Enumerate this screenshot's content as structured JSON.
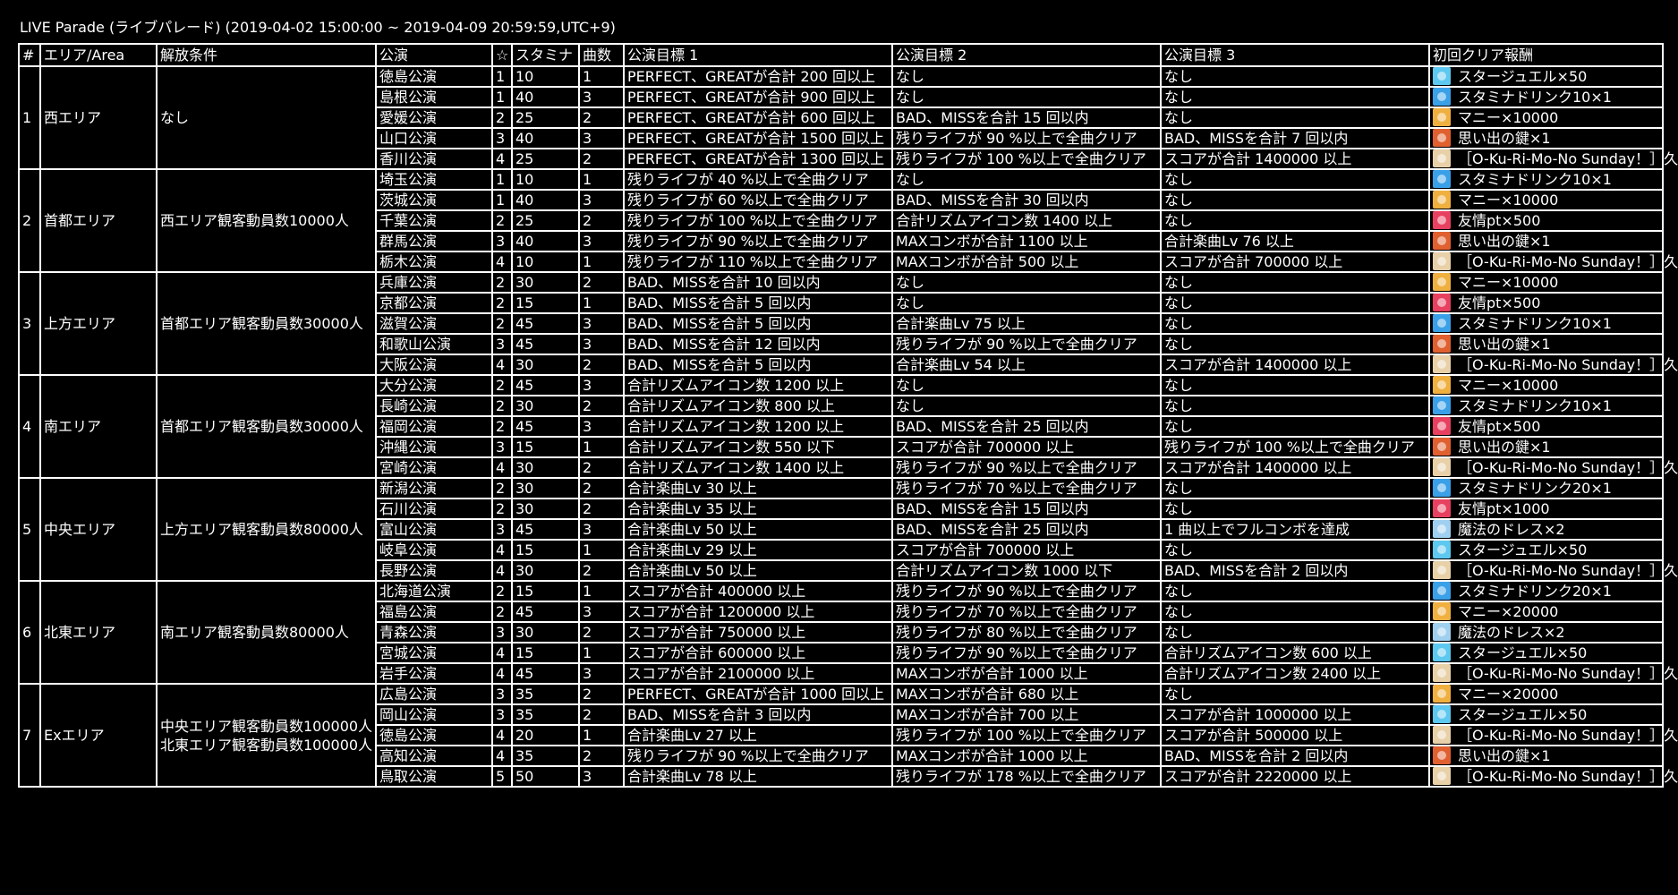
{
  "title": "LIVE Parade (ライブパレード) (2019-04-02 15:00:00 ~ 2019-04-09 20:59:59,UTC+9)",
  "columns": [
    "#",
    "エリア/Area",
    "解放条件",
    "公演",
    "☆",
    "スタミナ",
    "曲数",
    "公演目標 1",
    "公演目標 2",
    "公演目標 3",
    "初回クリア報酬"
  ],
  "reward_icons": {
    "jewel-icon": "#5dc8f0",
    "stamina-drink-icon": "#3aa0e8",
    "money-icon": "#f0b040",
    "key-icon": "#e06030",
    "card-icon": "#e8d0a8",
    "friend-pt-icon": "#e84060",
    "dress-icon": "#a0d0f0"
  },
  "areas": [
    {
      "num": "1",
      "name": "西エリア",
      "condition": [
        "なし"
      ],
      "lives": [
        {
          "name": "徳島公演",
          "star": "1",
          "stamina": "10",
          "songs": "1",
          "g1": "PERFECT、GREATが合計 200 回以上",
          "g2": "なし",
          "g3": "なし",
          "reward": "スタージュエル×50",
          "icon": "jewel-icon"
        },
        {
          "name": "島根公演",
          "star": "1",
          "stamina": "40",
          "songs": "3",
          "g1": "PERFECT、GREATが合計 900 回以上",
          "g2": "なし",
          "g3": "なし",
          "reward": "スタミナドリンク10×1",
          "icon": "stamina-drink-icon"
        },
        {
          "name": "愛媛公演",
          "star": "2",
          "stamina": "25",
          "songs": "2",
          "g1": "PERFECT、GREATが合計 600 回以上",
          "g2": "BAD、MISSを合計 15 回以内",
          "g3": "なし",
          "reward": "マニー×10000",
          "icon": "money-icon"
        },
        {
          "name": "山口公演",
          "star": "3",
          "stamina": "40",
          "songs": "3",
          "g1": "PERFECT、GREATが合計 1500 回以上",
          "g2": "残りライフが 90 %以上で全曲クリア",
          "g3": "BAD、MISSを合計 7 回以内",
          "reward": "思い出の鍵×1",
          "icon": "key-icon"
        },
        {
          "name": "香川公演",
          "star": "4",
          "stamina": "25",
          "songs": "2",
          "g1": "PERFECT、GREATが合計 1300 回以上",
          "g2": "残りライフが 100 %以上で全曲クリア",
          "g3": "スコアが合計 1400000 以上",
          "reward": "［O-Ku-Ri-Mo-No Sunday！］久",
          "icon": "card-icon"
        }
      ]
    },
    {
      "num": "2",
      "name": "首都エリア",
      "condition": [
        "西エリア観客動員数10000人"
      ],
      "lives": [
        {
          "name": "埼玉公演",
          "star": "1",
          "stamina": "10",
          "songs": "1",
          "g1": "残りライフが 40 %以上で全曲クリア",
          "g2": "なし",
          "g3": "なし",
          "reward": "スタミナドリンク10×1",
          "icon": "stamina-drink-icon"
        },
        {
          "name": "茨城公演",
          "star": "1",
          "stamina": "40",
          "songs": "3",
          "g1": "残りライフが 60 %以上で全曲クリア",
          "g2": "BAD、MISSを合計 30 回以内",
          "g3": "なし",
          "reward": "マニー×10000",
          "icon": "money-icon"
        },
        {
          "name": "千葉公演",
          "star": "2",
          "stamina": "25",
          "songs": "2",
          "g1": "残りライフが 100 %以上で全曲クリア",
          "g2": "合計リズムアイコン数 1400 以上",
          "g3": "なし",
          "reward": "友情pt×500",
          "icon": "friend-pt-icon"
        },
        {
          "name": "群馬公演",
          "star": "3",
          "stamina": "40",
          "songs": "3",
          "g1": "残りライフが 90 %以上で全曲クリア",
          "g2": "MAXコンボが合計 1100 以上",
          "g3": "合計楽曲Lv 76 以上",
          "reward": "思い出の鍵×1",
          "icon": "key-icon"
        },
        {
          "name": "栃木公演",
          "star": "4",
          "stamina": "10",
          "songs": "1",
          "g1": "残りライフが 110 %以上で全曲クリア",
          "g2": "MAXコンボが合計 500 以上",
          "g3": "スコアが合計 700000 以上",
          "reward": "［O-Ku-Ri-Mo-No Sunday！］久",
          "icon": "card-icon"
        }
      ]
    },
    {
      "num": "3",
      "name": "上方エリア",
      "condition": [
        "首都エリア観客動員数30000人"
      ],
      "lives": [
        {
          "name": "兵庫公演",
          "star": "2",
          "stamina": "30",
          "songs": "2",
          "g1": "BAD、MISSを合計 10 回以内",
          "g2": "なし",
          "g3": "なし",
          "reward": "マニー×10000",
          "icon": "money-icon"
        },
        {
          "name": "京都公演",
          "star": "2",
          "stamina": "15",
          "songs": "1",
          "g1": "BAD、MISSを合計 5 回以内",
          "g2": "なし",
          "g3": "なし",
          "reward": "友情pt×500",
          "icon": "friend-pt-icon"
        },
        {
          "name": "滋賀公演",
          "star": "2",
          "stamina": "45",
          "songs": "3",
          "g1": "BAD、MISSを合計 5 回以内",
          "g2": "合計楽曲Lv 75 以上",
          "g3": "なし",
          "reward": "スタミナドリンク10×1",
          "icon": "stamina-drink-icon"
        },
        {
          "name": "和歌山公演",
          "star": "3",
          "stamina": "45",
          "songs": "3",
          "g1": "BAD、MISSを合計 12 回以内",
          "g2": "残りライフが 90 %以上で全曲クリア",
          "g3": "なし",
          "reward": "思い出の鍵×1",
          "icon": "key-icon"
        },
        {
          "name": "大阪公演",
          "star": "4",
          "stamina": "30",
          "songs": "2",
          "g1": "BAD、MISSを合計 5 回以内",
          "g2": "合計楽曲Lv 54 以上",
          "g3": "スコアが合計 1400000 以上",
          "reward": "［O-Ku-Ri-Mo-No Sunday！］久",
          "icon": "card-icon"
        }
      ]
    },
    {
      "num": "4",
      "name": "南エリア",
      "condition": [
        "首都エリア観客動員数30000人"
      ],
      "lives": [
        {
          "name": "大分公演",
          "star": "2",
          "stamina": "45",
          "songs": "3",
          "g1": "合計リズムアイコン数 1200 以上",
          "g2": "なし",
          "g3": "なし",
          "reward": "マニー×10000",
          "icon": "money-icon"
        },
        {
          "name": "長崎公演",
          "star": "2",
          "stamina": "30",
          "songs": "2",
          "g1": "合計リズムアイコン数 800 以上",
          "g2": "なし",
          "g3": "なし",
          "reward": "スタミナドリンク10×1",
          "icon": "stamina-drink-icon"
        },
        {
          "name": "福岡公演",
          "star": "2",
          "stamina": "45",
          "songs": "3",
          "g1": "合計リズムアイコン数 1200 以上",
          "g2": "BAD、MISSを合計 25 回以内",
          "g3": "なし",
          "reward": "友情pt×500",
          "icon": "friend-pt-icon"
        },
        {
          "name": "沖縄公演",
          "star": "3",
          "stamina": "15",
          "songs": "1",
          "g1": "合計リズムアイコン数 550 以下",
          "g2": "スコアが合計 700000 以上",
          "g3": "残りライフが 100 %以上で全曲クリア",
          "reward": "思い出の鍵×1",
          "icon": "key-icon"
        },
        {
          "name": "宮崎公演",
          "star": "4",
          "stamina": "30",
          "songs": "2",
          "g1": "合計リズムアイコン数 1400 以上",
          "g2": "残りライフが 90 %以上で全曲クリア",
          "g3": "スコアが合計 1400000 以上",
          "reward": "［O-Ku-Ri-Mo-No Sunday！］久",
          "icon": "card-icon"
        }
      ]
    },
    {
      "num": "5",
      "name": "中央エリア",
      "condition": [
        "上方エリア観客動員数80000人"
      ],
      "lives": [
        {
          "name": "新潟公演",
          "star": "2",
          "stamina": "30",
          "songs": "2",
          "g1": "合計楽曲Lv 30 以上",
          "g2": "残りライフが 70 %以上で全曲クリア",
          "g3": "なし",
          "reward": "スタミナドリンク20×1",
          "icon": "stamina-drink-icon"
        },
        {
          "name": "石川公演",
          "star": "2",
          "stamina": "30",
          "songs": "2",
          "g1": "合計楽曲Lv 35 以上",
          "g2": "BAD、MISSを合計 15 回以内",
          "g3": "なし",
          "reward": "友情pt×1000",
          "icon": "friend-pt-icon"
        },
        {
          "name": "富山公演",
          "star": "3",
          "stamina": "45",
          "songs": "3",
          "g1": "合計楽曲Lv 50 以上",
          "g2": "BAD、MISSを合計 25 回以内",
          "g3": "1 曲以上でフルコンボを達成",
          "reward": "魔法のドレス×2",
          "icon": "dress-icon"
        },
        {
          "name": "岐阜公演",
          "star": "4",
          "stamina": "15",
          "songs": "1",
          "g1": "合計楽曲Lv 29 以上",
          "g2": "スコアが合計 700000 以上",
          "g3": "なし",
          "reward": "スタージュエル×50",
          "icon": "jewel-icon"
        },
        {
          "name": "長野公演",
          "star": "4",
          "stamina": "30",
          "songs": "2",
          "g1": "合計楽曲Lv 50 以上",
          "g2": "合計リズムアイコン数 1000 以下",
          "g3": "BAD、MISSを合計 2 回以内",
          "reward": "［O-Ku-Ri-Mo-No Sunday！］久",
          "icon": "card-icon"
        }
      ]
    },
    {
      "num": "6",
      "name": "北東エリア",
      "condition": [
        "南エリア観客動員数80000人"
      ],
      "lives": [
        {
          "name": "北海道公演",
          "star": "2",
          "stamina": "15",
          "songs": "1",
          "g1": "スコアが合計 400000 以上",
          "g2": "残りライフが 90 %以上で全曲クリア",
          "g3": "なし",
          "reward": "スタミナドリンク20×1",
          "icon": "stamina-drink-icon"
        },
        {
          "name": "福島公演",
          "star": "2",
          "stamina": "45",
          "songs": "3",
          "g1": "スコアが合計 1200000 以上",
          "g2": "残りライフが 70 %以上で全曲クリア",
          "g3": "なし",
          "reward": "マニー×20000",
          "icon": "money-icon"
        },
        {
          "name": "青森公演",
          "star": "3",
          "stamina": "30",
          "songs": "2",
          "g1": "スコアが合計 750000 以上",
          "g2": "残りライフが 80 %以上で全曲クリア",
          "g3": "なし",
          "reward": "魔法のドレス×2",
          "icon": "dress-icon"
        },
        {
          "name": "宮城公演",
          "star": "4",
          "stamina": "15",
          "songs": "1",
          "g1": "スコアが合計 600000 以上",
          "g2": "残りライフが 90 %以上で全曲クリア",
          "g3": "合計リズムアイコン数 600 以上",
          "reward": "スタージュエル×50",
          "icon": "jewel-icon"
        },
        {
          "name": "岩手公演",
          "star": "4",
          "stamina": "45",
          "songs": "3",
          "g1": "スコアが合計 2100000 以上",
          "g2": "MAXコンボが合計 1000 以上",
          "g3": "合計リズムアイコン数 2400 以上",
          "reward": "［O-Ku-Ri-Mo-No Sunday！］久",
          "icon": "card-icon"
        }
      ]
    },
    {
      "num": "7",
      "name": "Exエリア",
      "condition": [
        "中央エリア観客動員数100000人",
        "北東エリア観客動員数100000人"
      ],
      "lives": [
        {
          "name": "広島公演",
          "star": "3",
          "stamina": "35",
          "songs": "2",
          "g1": "PERFECT、GREATが合計 1000 回以上",
          "g2": "MAXコンボが合計 680 以上",
          "g3": "なし",
          "reward": "マニー×20000",
          "icon": "money-icon"
        },
        {
          "name": "岡山公演",
          "star": "3",
          "stamina": "35",
          "songs": "2",
          "g1": "BAD、MISSを合計 3 回以内",
          "g2": "MAXコンボが合計 700 以上",
          "g3": "スコアが合計 1000000 以上",
          "reward": "スタージュエル×50",
          "icon": "jewel-icon"
        },
        {
          "name": "徳島公演",
          "star": "4",
          "stamina": "20",
          "songs": "1",
          "g1": "合計楽曲Lv 27 以上",
          "g2": "残りライフが 100 %以上で全曲クリア",
          "g3": "スコアが合計 500000 以上",
          "reward": "［O-Ku-Ri-Mo-No Sunday！］久",
          "icon": "card-icon"
        },
        {
          "name": "高知公演",
          "star": "4",
          "stamina": "35",
          "songs": "2",
          "g1": "残りライフが 90 %以上で全曲クリア",
          "g2": "MAXコンボが合計 1000 以上",
          "g3": "BAD、MISSを合計 2 回以内",
          "reward": "思い出の鍵×1",
          "icon": "key-icon"
        },
        {
          "name": "鳥取公演",
          "star": "5",
          "stamina": "50",
          "songs": "3",
          "g1": "合計楽曲Lv 78 以上",
          "g2": "残りライフが 178 %以上で全曲クリア",
          "g3": "スコアが合計 2220000 以上",
          "reward": "［O-Ku-Ri-Mo-No Sunday！］久",
          "icon": "card-icon"
        }
      ]
    }
  ]
}
